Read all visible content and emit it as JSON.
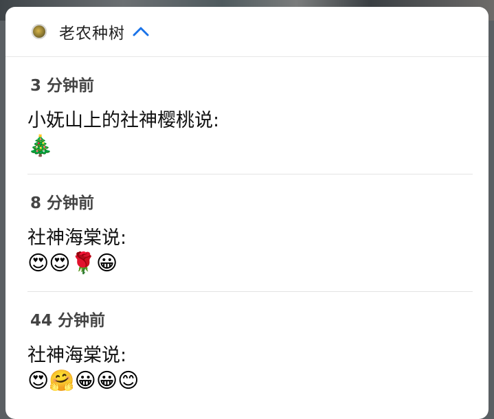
{
  "app": {
    "name": "老农种树",
    "icon": "app-logo-icon",
    "expand_icon": "chevron-up-icon",
    "accent_color": "#1a73e8"
  },
  "notifications": [
    {
      "time": "3 分钟前",
      "title": "小妩山上的社神樱桃说:",
      "body": "🎄"
    },
    {
      "time": "8 分钟前",
      "title": "社神海棠说:",
      "body": "😍😍🌹😀"
    },
    {
      "time": "44 分钟前",
      "title": "社神海棠说:",
      "body": "😍🤗😀😀😊"
    }
  ]
}
